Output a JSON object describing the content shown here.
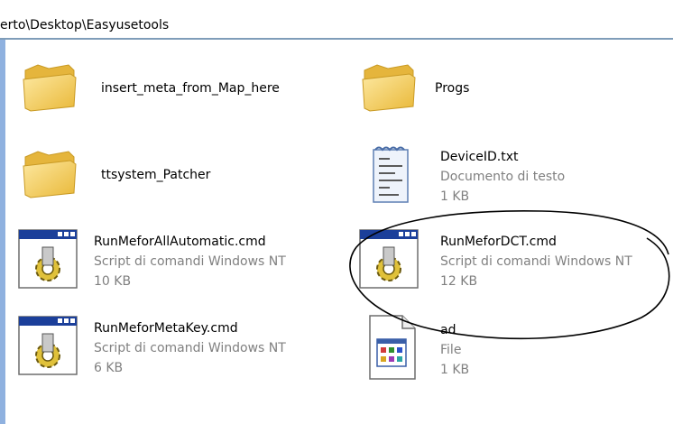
{
  "address": {
    "path": "erto\\Desktop\\Easyusetools"
  },
  "items": [
    {
      "name": "insert_meta_from_Map_here",
      "line2": "",
      "line3": "",
      "icon": "folder-icon"
    },
    {
      "name": "Progs",
      "line2": "",
      "line3": "",
      "icon": "folder-icon"
    },
    {
      "name": "ttsystem_Patcher",
      "line2": "",
      "line3": "",
      "icon": "folder-icon"
    },
    {
      "name": "DeviceID.txt",
      "line2": "Documento di testo",
      "line3": "1 KB",
      "icon": "notepad-icon"
    },
    {
      "name": "RunMeforAllAutomatic.cmd",
      "line2": "Script di comandi Windows NT",
      "line3": "10 KB",
      "icon": "cmd-script-icon"
    },
    {
      "name": "RunMeforDCT.cmd",
      "line2": "Script di comandi Windows NT",
      "line3": "12 KB",
      "icon": "cmd-script-icon"
    },
    {
      "name": "RunMeforMetaKey.cmd",
      "line2": "Script di comandi Windows NT",
      "line3": "6 KB",
      "icon": "cmd-script-icon"
    },
    {
      "name": "ad",
      "line2": "File",
      "line3": "1 KB",
      "icon": "generic-file-icon"
    }
  ],
  "colors": {
    "folder": "#f5cf5a",
    "folder_dark": "#d9a520",
    "highlight_oval": "#000000",
    "secondary_text": "#808080"
  }
}
